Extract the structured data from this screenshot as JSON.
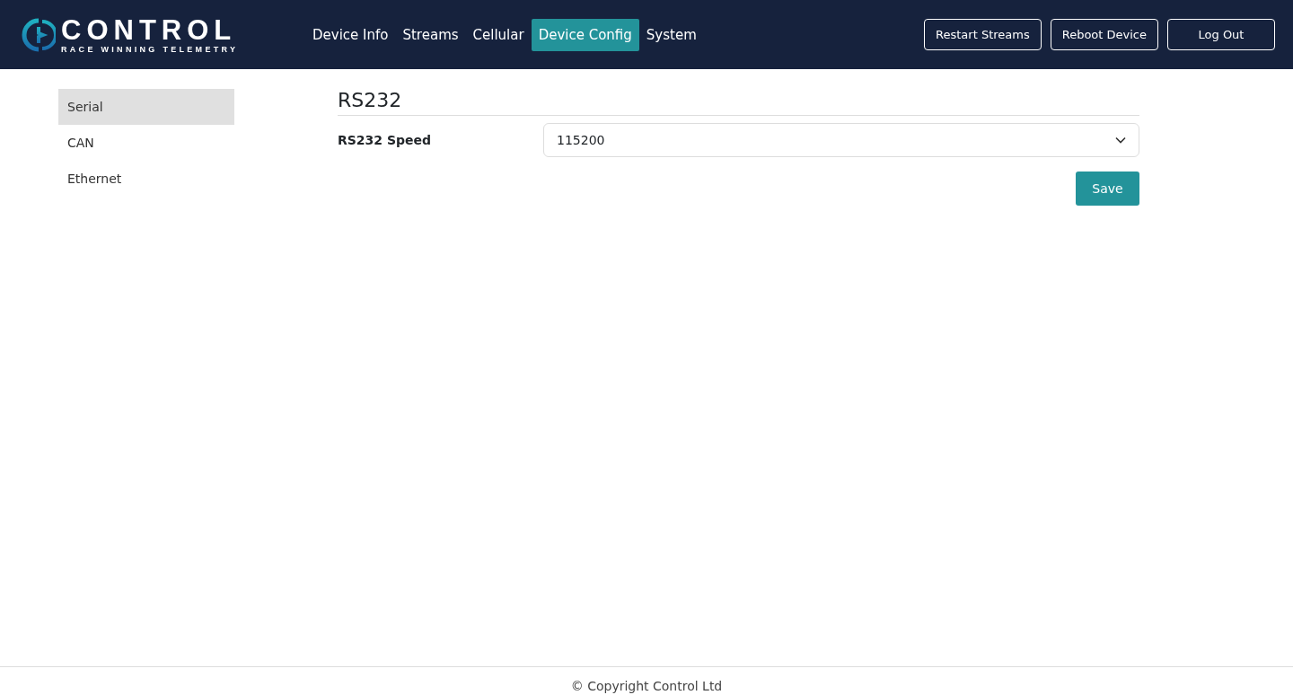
{
  "logo": {
    "name": "CONTROL",
    "tagline": "RACE WINNING TELEMETRY"
  },
  "nav": [
    {
      "label": "Device Info",
      "selected": false
    },
    {
      "label": "Streams",
      "selected": false
    },
    {
      "label": "Cellular",
      "selected": false
    },
    {
      "label": "Device Config",
      "selected": true
    },
    {
      "label": "System",
      "selected": false
    }
  ],
  "actions": [
    "Restart Streams",
    "Reboot Device",
    "Log Out"
  ],
  "sidebar": {
    "items": [
      {
        "label": "Serial",
        "selected": true
      },
      {
        "label": "CAN",
        "selected": false
      },
      {
        "label": "Ethernet",
        "selected": false
      }
    ]
  },
  "section": {
    "title": "RS232",
    "field": {
      "label": "RS232 Speed",
      "value": "115200"
    },
    "button": "Save"
  },
  "footer": "© Copyright Control Ltd"
}
